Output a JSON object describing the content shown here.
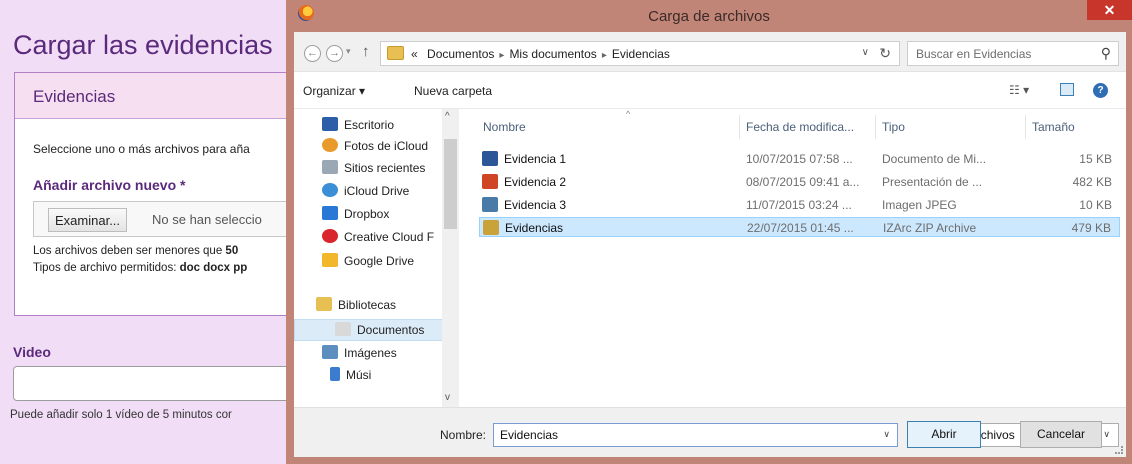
{
  "web_page": {
    "title": "Cargar las evidencias",
    "panel_title": "Evidencias",
    "instruction": "Seleccione uno o más archivos para aña",
    "add_file_label": "Añadir archivo nuevo *",
    "browse_button": "Examinar...",
    "file_status": "No se han seleccio",
    "size_note_prefix": "Los archivos deben ser menores que ",
    "size_note_value": "50",
    "types_note_prefix": "Tipos de archivo permitidos: ",
    "types_note_value": "doc docx pp",
    "video_label": "Video",
    "video_note": "Puede añadir solo 1 vídeo de 5 minutos cor"
  },
  "dialog": {
    "title": "Carga de archivos",
    "close_glyph": "✕",
    "back_glyph": "←",
    "forward_glyph": "→",
    "recent_glyph": "▾",
    "up_glyph": "↑",
    "path_prefix": "«",
    "path_separator": "▸",
    "breadcrumb": [
      "Documentos",
      "Mis documentos",
      "Evidencias"
    ],
    "addr_dropdown_glyph": "∨",
    "refresh_glyph": "↻",
    "search_placeholder": "Buscar en Evidencias",
    "search_glyph": "⚲",
    "toolbar": {
      "organize": "Organizar ▾",
      "new_folder": "Nueva carpeta",
      "view_glyph": "☷ ▾",
      "help_glyph": "?"
    },
    "nav_items": [
      {
        "label": "Escritorio",
        "icon": "desktop-icon",
        "color": "#2d5fa8"
      },
      {
        "label": "Fotos de iCloud",
        "icon": "photos-icon",
        "color": "#e99a2c"
      },
      {
        "label": "Sitios recientes",
        "icon": "recent-places-icon",
        "color": "#9aa7b4"
      },
      {
        "label": "iCloud Drive",
        "icon": "cloud-icon",
        "color": "#3b8fd6"
      },
      {
        "label": "Dropbox",
        "icon": "dropbox-icon",
        "color": "#2a78d6"
      },
      {
        "label": "Creative Cloud F",
        "icon": "creative-cloud-icon",
        "color": "#d8262c"
      },
      {
        "label": "Google Drive",
        "icon": "google-drive-icon",
        "color": "#f2b72b"
      },
      {
        "label": "Bibliotecas",
        "icon": "libraries-icon",
        "color": "#e8bf52"
      },
      {
        "label": "Documentos",
        "icon": "documents-icon",
        "color": "#d9d9d9",
        "selected": true
      },
      {
        "label": "Imágenes",
        "icon": "pictures-icon",
        "color": "#5c8fbf"
      },
      {
        "label": "Músi",
        "icon": "music-icon",
        "color": "#3b7ccf"
      }
    ],
    "nav_scroll": {
      "up_glyph": "^",
      "down_glyph": "v"
    },
    "sort_glyph": "^",
    "columns": [
      "Nombre",
      "Fecha de modifica...",
      "Tipo",
      "Tamaño"
    ],
    "files": [
      {
        "name": "Evidencia 1",
        "date": "10/07/2015 07:58 ...",
        "type": "Documento de Mi...",
        "size": "15 KB",
        "icon": "word-document-icon",
        "color": "#2b5797"
      },
      {
        "name": "Evidencia 2",
        "date": "08/07/2015 09:41 a...",
        "type": "Presentación de ...",
        "size": "482 KB",
        "icon": "powerpoint-icon",
        "color": "#d04525"
      },
      {
        "name": "Evidencia 3",
        "date": "11/07/2015 03:24 ...",
        "type": "Imagen JPEG",
        "size": "10 KB",
        "icon": "image-file-icon",
        "color": "#4a7aa8"
      },
      {
        "name": "Evidencias",
        "date": "22/07/2015 01:45 ...",
        "type": "IZArc ZIP Archive",
        "size": "479 KB",
        "icon": "zip-archive-icon",
        "color": "#c9a23a",
        "selected": true
      }
    ],
    "filename_label": "Nombre:",
    "filename_value": "Evidencias",
    "filetype_value": "Todos los archivos",
    "dropdown_glyph": "∨",
    "open_button": "Abrir",
    "cancel_button": "Cancelar"
  }
}
